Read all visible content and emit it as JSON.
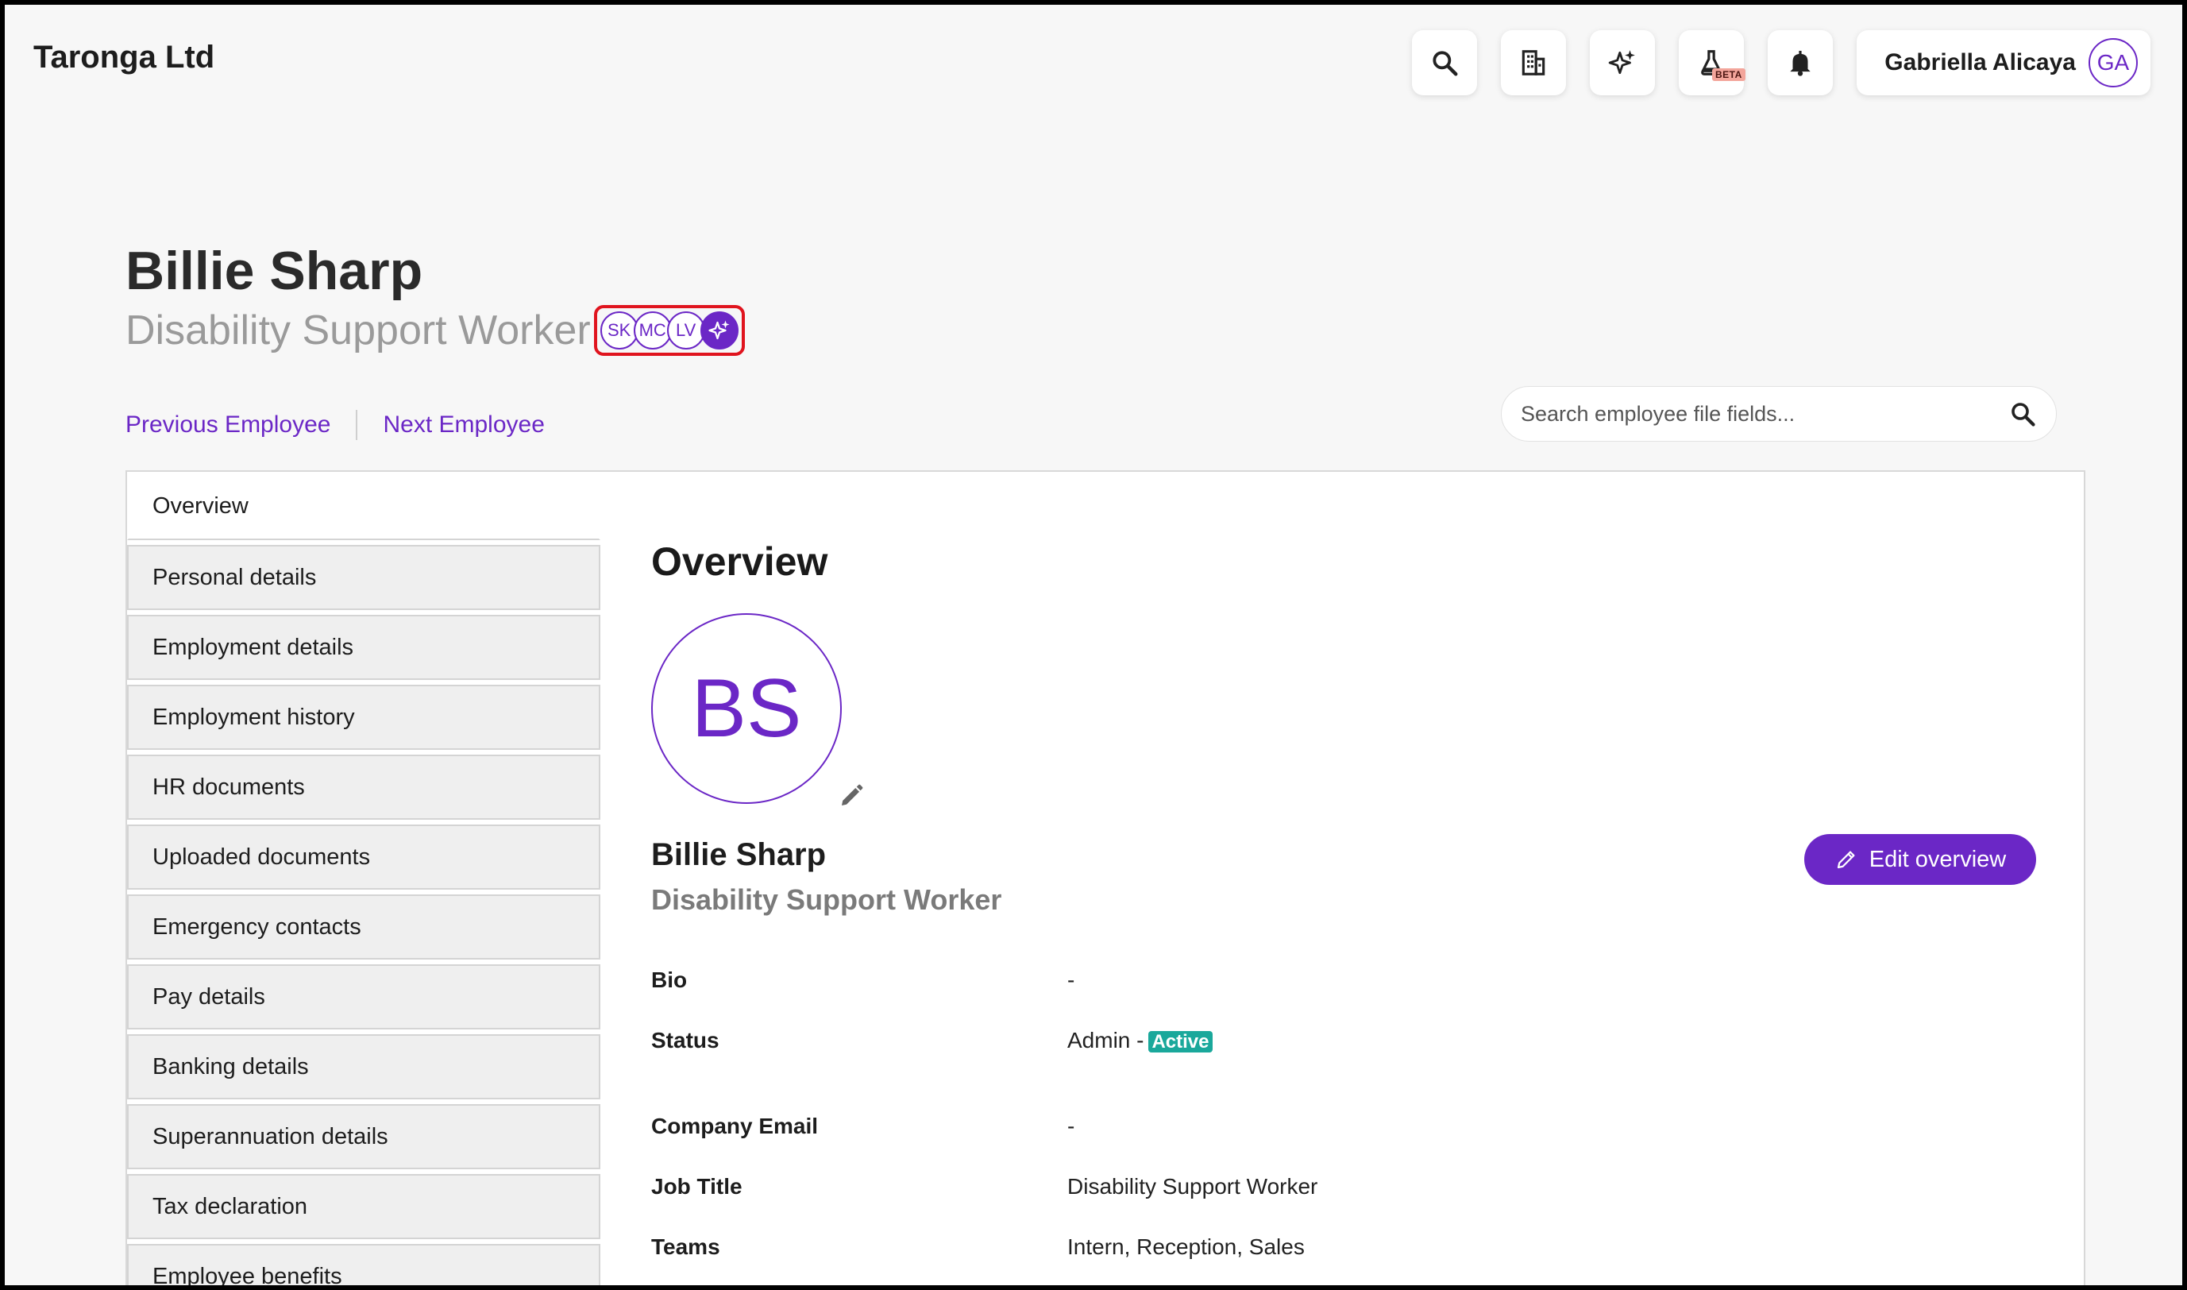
{
  "brand": "Taronga Ltd",
  "topbar": {
    "icons": [
      "search-icon",
      "building-icon",
      "sparkle-icon",
      "flask-icon",
      "bell-icon"
    ],
    "beta_label": "BETA",
    "user_name": "Gabriella Alicaya",
    "user_initials": "GA"
  },
  "employee": {
    "name": "Billie Sharp",
    "role": "Disability Support Worker",
    "collaborators": [
      "SK",
      "MC",
      "LV"
    ]
  },
  "nav": {
    "previous": "Previous Employee",
    "next": "Next Employee"
  },
  "file_search": {
    "placeholder": "Search employee file fields..."
  },
  "tabs": [
    "Overview",
    "Personal details",
    "Employment details",
    "Employment history",
    "HR documents",
    "Uploaded documents",
    "Emergency contacts",
    "Pay details",
    "Banking details",
    "Superannuation details",
    "Tax declaration",
    "Employee benefits"
  ],
  "overview": {
    "title": "Overview",
    "initials": "BS",
    "name": "Billie Sharp",
    "role": "Disability Support Worker",
    "edit_label": "Edit overview",
    "fields": {
      "bio_label": "Bio",
      "bio_value": "-",
      "status_label": "Status",
      "status_value": "Admin -",
      "status_badge": "Active",
      "email_label": "Company Email",
      "email_value": "-",
      "job_label": "Job Title",
      "job_value": "Disability Support Worker",
      "teams_label": "Teams",
      "teams_value": "Intern, Reception, Sales"
    }
  },
  "colors": {
    "accent": "#6b27c6",
    "highlight_border": "#e0141e",
    "active_badge": "#1aa89b"
  }
}
